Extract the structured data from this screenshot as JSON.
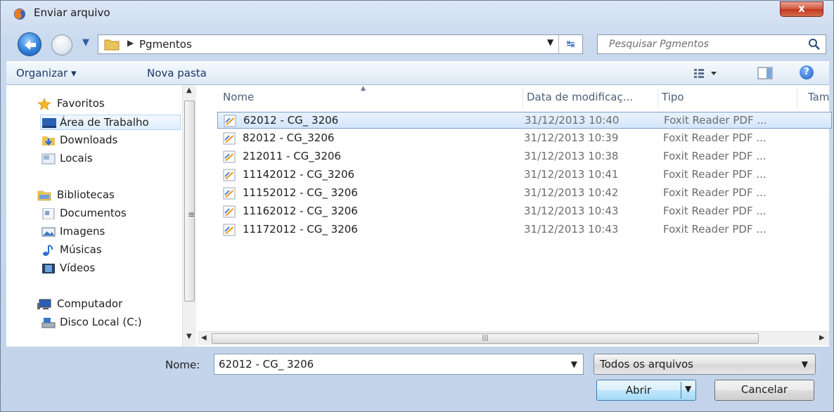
{
  "window": {
    "title": "Enviar arquivo",
    "close_label": "x"
  },
  "address": {
    "current_folder": "Pgmentos"
  },
  "search": {
    "placeholder": "Pesquisar Pgmentos"
  },
  "toolbar": {
    "organize_label": "Organizar ▾",
    "new_folder_label": "Nova pasta"
  },
  "sidebar": {
    "favorites": {
      "label": "Favoritos",
      "items": [
        {
          "label": "Área de Trabalho",
          "icon": "desktop-icon"
        },
        {
          "label": "Downloads",
          "icon": "downloads-icon"
        },
        {
          "label": "Locais",
          "icon": "recent-places-icon"
        }
      ]
    },
    "libraries": {
      "label": "Bibliotecas",
      "items": [
        {
          "label": "Documentos",
          "icon": "documents-icon"
        },
        {
          "label": "Imagens",
          "icon": "pictures-icon"
        },
        {
          "label": "Músicas",
          "icon": "music-icon"
        },
        {
          "label": "Vídeos",
          "icon": "videos-icon"
        }
      ]
    },
    "computer": {
      "label": "Computador",
      "items": [
        {
          "label": "Disco Local (C:)",
          "icon": "local-disk-icon"
        }
      ]
    }
  },
  "columns": {
    "name": "Nome",
    "date": "Data de modificaç...",
    "type": "Tipo",
    "size": "Tam"
  },
  "files": [
    {
      "name": "62012 - CG_ 3206",
      "date": "31/12/2013 10:40",
      "type": "Foxit Reader PDF ...",
      "selected": true
    },
    {
      "name": "82012 - CG_3206",
      "date": "31/12/2013 10:39",
      "type": "Foxit Reader PDF ..."
    },
    {
      "name": "212011 - CG_3206",
      "date": "31/12/2013 10:38",
      "type": "Foxit Reader PDF ..."
    },
    {
      "name": "11142012 - CG_3206",
      "date": "31/12/2013 10:41",
      "type": "Foxit Reader PDF ..."
    },
    {
      "name": "11152012 - CG_ 3206",
      "date": "31/12/2013 10:42",
      "type": "Foxit Reader PDF ..."
    },
    {
      "name": "11162012 - CG_ 3206",
      "date": "31/12/2013 10:43",
      "type": "Foxit Reader PDF ..."
    },
    {
      "name": "11172012 - CG_ 3206",
      "date": "31/12/2013 10:43",
      "type": "Foxit Reader PDF ..."
    }
  ],
  "bottom": {
    "name_label": "Nome:",
    "name_value": "62012 - CG_ 3206",
    "filter_value": "Todos os arquivos",
    "open_label": "Abrir",
    "cancel_label": "Cancelar"
  },
  "colors": {
    "selection": "#d4e6fb",
    "selection_border": "#7da2ce",
    "toolbar_text": "#1e3968",
    "header_text": "#4c607a"
  }
}
